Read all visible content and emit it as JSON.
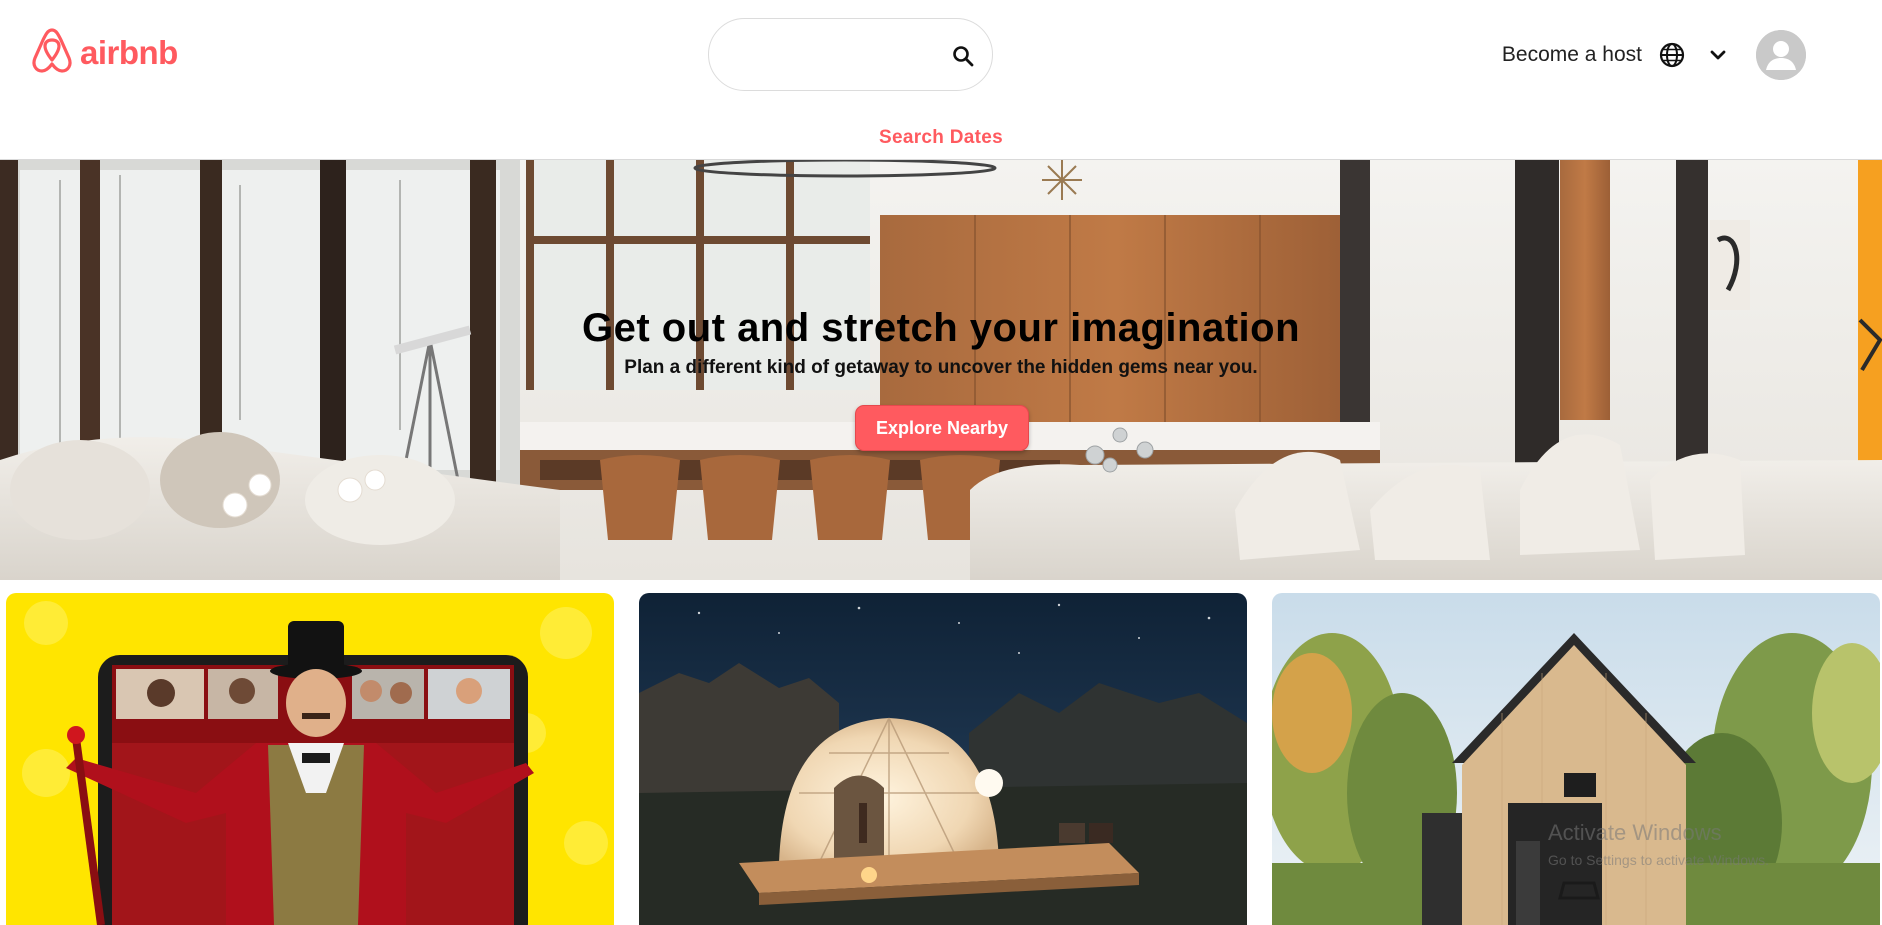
{
  "header": {
    "logo_text": "airbnb",
    "logo_icon": "airbnb-belo-icon",
    "search": {
      "placeholder": "",
      "icon": "search-icon"
    },
    "search_dates_label": "Search Dates",
    "become_host_label": "Become a host",
    "language_icon": "globe-icon",
    "menu_icon": "chevron-down-icon",
    "avatar_icon": "user-avatar-icon"
  },
  "hero": {
    "title": "Get out and stretch your imagination",
    "subtitle": "Plan a different kind of getaway to uncover the hidden gems near you.",
    "cta_label": "Explore Nearby"
  },
  "cards": [
    {
      "image": "online-experience-ringmaster-photo"
    },
    {
      "image": "geodesic-dome-night-photo"
    },
    {
      "image": "a-frame-cabin-forest-photo"
    }
  ],
  "os_overlay": {
    "title": "Activate Windows",
    "subtitle": "Go to Settings to activate Windows."
  },
  "colors": {
    "brand": "#ff5a5f",
    "text": "#222222",
    "card_yellow": "#ffe500"
  }
}
